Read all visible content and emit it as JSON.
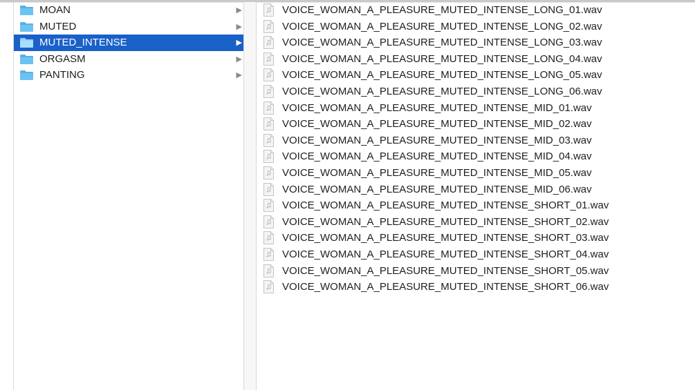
{
  "folders": [
    {
      "label": "MOAN",
      "icon": "folder-icon",
      "selected": false
    },
    {
      "label": "MUTED",
      "icon": "folder-icon",
      "selected": false
    },
    {
      "label": "MUTED_INTENSE",
      "icon": "folder-icon",
      "selected": true
    },
    {
      "label": "ORGASM",
      "icon": "folder-icon",
      "selected": false
    },
    {
      "label": "PANTING",
      "icon": "folder-icon",
      "selected": false
    }
  ],
  "chevron_glyph": "▶",
  "files": [
    {
      "label": "VOICE_WOMAN_A_PLEASURE_MUTED_INTENSE_LONG_01.wav",
      "icon": "audio-file-icon"
    },
    {
      "label": "VOICE_WOMAN_A_PLEASURE_MUTED_INTENSE_LONG_02.wav",
      "icon": "audio-file-icon"
    },
    {
      "label": "VOICE_WOMAN_A_PLEASURE_MUTED_INTENSE_LONG_03.wav",
      "icon": "audio-file-icon"
    },
    {
      "label": "VOICE_WOMAN_A_PLEASURE_MUTED_INTENSE_LONG_04.wav",
      "icon": "audio-file-icon"
    },
    {
      "label": "VOICE_WOMAN_A_PLEASURE_MUTED_INTENSE_LONG_05.wav",
      "icon": "audio-file-icon"
    },
    {
      "label": "VOICE_WOMAN_A_PLEASURE_MUTED_INTENSE_LONG_06.wav",
      "icon": "audio-file-icon"
    },
    {
      "label": "VOICE_WOMAN_A_PLEASURE_MUTED_INTENSE_MID_01.wav",
      "icon": "audio-file-icon"
    },
    {
      "label": "VOICE_WOMAN_A_PLEASURE_MUTED_INTENSE_MID_02.wav",
      "icon": "audio-file-icon"
    },
    {
      "label": "VOICE_WOMAN_A_PLEASURE_MUTED_INTENSE_MID_03.wav",
      "icon": "audio-file-icon"
    },
    {
      "label": "VOICE_WOMAN_A_PLEASURE_MUTED_INTENSE_MID_04.wav",
      "icon": "audio-file-icon"
    },
    {
      "label": "VOICE_WOMAN_A_PLEASURE_MUTED_INTENSE_MID_05.wav",
      "icon": "audio-file-icon"
    },
    {
      "label": "VOICE_WOMAN_A_PLEASURE_MUTED_INTENSE_MID_06.wav",
      "icon": "audio-file-icon"
    },
    {
      "label": "VOICE_WOMAN_A_PLEASURE_MUTED_INTENSE_SHORT_01.wav",
      "icon": "audio-file-icon"
    },
    {
      "label": "VOICE_WOMAN_A_PLEASURE_MUTED_INTENSE_SHORT_02.wav",
      "icon": "audio-file-icon"
    },
    {
      "label": "VOICE_WOMAN_A_PLEASURE_MUTED_INTENSE_SHORT_03.wav",
      "icon": "audio-file-icon"
    },
    {
      "label": "VOICE_WOMAN_A_PLEASURE_MUTED_INTENSE_SHORT_04.wav",
      "icon": "audio-file-icon"
    },
    {
      "label": "VOICE_WOMAN_A_PLEASURE_MUTED_INTENSE_SHORT_05.wav",
      "icon": "audio-file-icon"
    },
    {
      "label": "VOICE_WOMAN_A_PLEASURE_MUTED_INTENSE_SHORT_06.wav",
      "icon": "audio-file-icon"
    }
  ],
  "colors": {
    "selection": "#1a60c9",
    "folder_icon": "#6cc3f2",
    "folder_icon_tab": "#5ab0e3",
    "divider": "#d9d9d9",
    "text": "#1e1e1e"
  }
}
